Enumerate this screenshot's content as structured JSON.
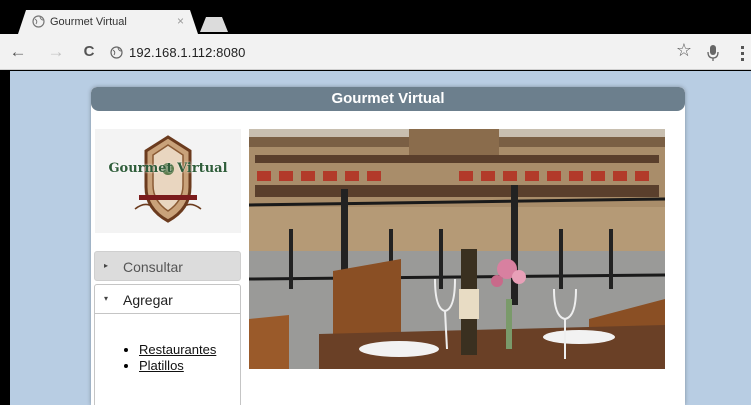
{
  "browser": {
    "tab_title": "Gourmet Virtual",
    "tab_close": "×",
    "url": "192.168.1.112:8080",
    "back_icon": "←",
    "forward_icon": "→",
    "reload_icon": "C",
    "star_icon": "☆"
  },
  "page": {
    "header_title": "Gourmet Virtual",
    "logo_text": "Gourmet Virtual",
    "menu": {
      "consultar": {
        "label": "Consultar",
        "arrow": "▸",
        "expanded": false
      },
      "agregar": {
        "label": "Agregar",
        "arrow": "▾",
        "expanded": true,
        "links": [
          "Restaurantes",
          "Platillos"
        ]
      }
    }
  },
  "colors": {
    "page_background": "#b8cde3",
    "header_bar": "#6c7f8d",
    "toolbar": "#f2f2f2"
  }
}
